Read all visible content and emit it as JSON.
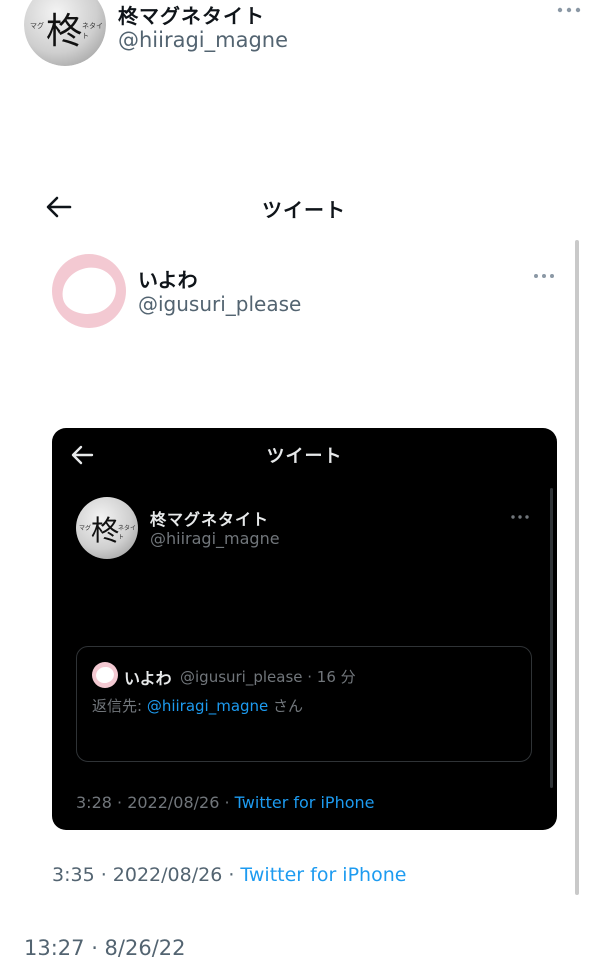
{
  "outer": {
    "author": {
      "name": "柊マグネタイト",
      "handle": "@hiiragi_magne",
      "avatar_kanji": "柊",
      "avatar_small_left": "マグ",
      "avatar_small_right": "ネタイト"
    },
    "timestamp": "13:27 · 8/26/22"
  },
  "screen": {
    "title": "ツイート",
    "author": {
      "name": "いよわ",
      "handle": "@igusuri_please"
    },
    "footer": {
      "time": "3:35 · 2022/08/26 · ",
      "client": "Twitter for iPhone"
    }
  },
  "embedded": {
    "title": "ツイート",
    "author": {
      "name": "柊マグネタイト",
      "handle": "@hiiragi_magne",
      "avatar_kanji": "柊",
      "avatar_small_left": "マグ",
      "avatar_small_right": "ネタイト"
    },
    "quote": {
      "name": "いよわ",
      "meta": "@igusuri_please · 16 分",
      "reply_prefix": "返信先: ",
      "reply_mention": "@hiiragi_magne",
      "reply_suffix": " さん"
    },
    "footer": {
      "time": "3:28 · 2022/08/26 · ",
      "client": "Twitter for iPhone"
    }
  },
  "colors": {
    "link": "#1d9bf0",
    "secondary": "#536471",
    "dark_bg": "#000000",
    "pink": "#f3c9d2"
  },
  "icons": [
    "more-icon",
    "back-arrow-icon"
  ]
}
